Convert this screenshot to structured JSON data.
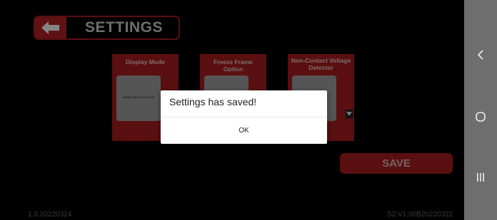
{
  "header": {
    "title": "SETTINGS"
  },
  "cards": [
    {
      "title": "Display Mode",
      "value": "Always Up Full Screen"
    },
    {
      "title": "Freeze Frame Option",
      "value": ""
    },
    {
      "title": "Non-Contact Voltage Detector",
      "value": ""
    }
  ],
  "save_label": "SAVE",
  "dialog": {
    "message": "Settings has saved!",
    "ok_label": "OK"
  },
  "footer": {
    "version_left": "1.0.20220324",
    "version_right": "S2:V1.00B20220322"
  },
  "navbar": {
    "back_icon": "chevron-left-icon",
    "home_icon": "circle-home-icon",
    "recents_icon": "recents-bars-icon"
  },
  "colors": {
    "accent": "#a51d20",
    "overlay": "#000000",
    "navbar": "#6e6e6e"
  }
}
